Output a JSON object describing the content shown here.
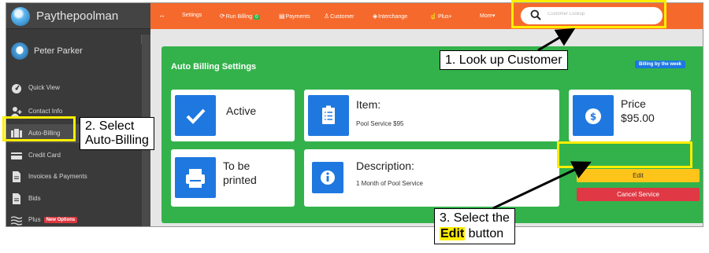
{
  "app": {
    "name": "Paythepoolman"
  },
  "user": {
    "name": "Peter Parker"
  },
  "sidebar": {
    "items": [
      {
        "label": "Quick View",
        "icon": "dashboard-icon"
      },
      {
        "label": "Contact Info",
        "icon": "person-add-icon"
      },
      {
        "label": "Auto-Billing",
        "icon": "tiles-icon"
      },
      {
        "label": "Credit Card",
        "icon": "credit-card-icon"
      },
      {
        "label": "Invoices & Payments",
        "icon": "document-icon"
      },
      {
        "label": "Bids",
        "icon": "document-icon"
      },
      {
        "label": "Plus",
        "icon": "waves-icon",
        "badge": "New Options"
      }
    ]
  },
  "topbar": {
    "expand_glyph": "↔",
    "items": [
      {
        "label": "Settings"
      },
      {
        "label": "Run Billing",
        "count": "0"
      },
      {
        "label": "Payments"
      },
      {
        "label": "Customer"
      },
      {
        "label": "Interchange"
      },
      {
        "label": "Plus+"
      },
      {
        "label": "More▾"
      }
    ],
    "search_placeholder": "Customer Lookup"
  },
  "billing": {
    "title": "Auto Billing Settings",
    "frequency_badge": "Billing by the week",
    "status": "Active",
    "item_heading": "Item:",
    "item_value": "Pool Service $95",
    "price_heading": "Price",
    "price_value": "$95.00",
    "print_line1": "To be",
    "print_line2": "printed",
    "description_heading": "Description:",
    "description_value": "1 Month of Pool Service",
    "edit_label": "Edit",
    "cancel_label": "Cancel Service"
  },
  "annotations": {
    "step1": "1. Look up Customer",
    "step2_line1": "2. Select",
    "step2_line2": "Auto-Billing",
    "step3_line1": "3. Select the",
    "step3_em": "Edit",
    "step3_rest": " button",
    "highlight_color": "#ffee00"
  },
  "colors": {
    "topbar": "#f56a2c",
    "card_green": "#33b24b",
    "icon_blue": "#1e78e0",
    "edit_yellow": "#ffc41a",
    "cancel_red": "#e03844",
    "sidebar": "#3a3a3a"
  }
}
